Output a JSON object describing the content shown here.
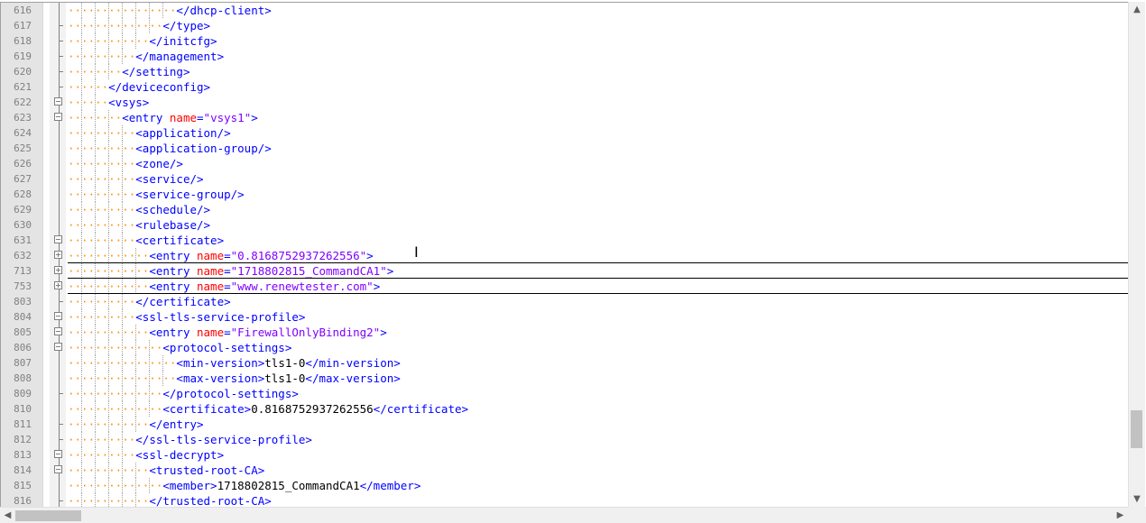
{
  "editor": {
    "lines": [
      {
        "num": "616",
        "indent": 8,
        "fold": "line",
        "tokens": [
          [
            "tag",
            "</dhcp-client>"
          ]
        ]
      },
      {
        "num": "617",
        "indent": 7,
        "fold": "end",
        "tokens": [
          [
            "tag",
            "</type>"
          ]
        ]
      },
      {
        "num": "618",
        "indent": 6,
        "fold": "end",
        "tokens": [
          [
            "tag",
            "</initcfg>"
          ]
        ]
      },
      {
        "num": "619",
        "indent": 5,
        "fold": "end",
        "tokens": [
          [
            "tag",
            "</management>"
          ]
        ]
      },
      {
        "num": "620",
        "indent": 4,
        "fold": "end",
        "tokens": [
          [
            "tag",
            "</setting>"
          ]
        ]
      },
      {
        "num": "621",
        "indent": 3,
        "fold": "end",
        "tokens": [
          [
            "tag",
            "</deviceconfig>"
          ]
        ]
      },
      {
        "num": "622",
        "indent": 3,
        "fold": "minus",
        "tokens": [
          [
            "tag",
            "<vsys>"
          ]
        ]
      },
      {
        "num": "623",
        "indent": 4,
        "fold": "minus",
        "tokens": [
          [
            "tag",
            "<entry "
          ],
          [
            "attr",
            "name"
          ],
          [
            "tag",
            "="
          ],
          [
            "val",
            "\"vsys1\""
          ],
          [
            "tag",
            ">"
          ]
        ]
      },
      {
        "num": "624",
        "indent": 5,
        "fold": "line",
        "tokens": [
          [
            "tag",
            "<application/>"
          ]
        ]
      },
      {
        "num": "625",
        "indent": 5,
        "fold": "line",
        "tokens": [
          [
            "tag",
            "<application-group/>"
          ]
        ]
      },
      {
        "num": "626",
        "indent": 5,
        "fold": "line",
        "tokens": [
          [
            "tag",
            "<zone/>"
          ]
        ]
      },
      {
        "num": "627",
        "indent": 5,
        "fold": "line",
        "tokens": [
          [
            "tag",
            "<service/>"
          ]
        ]
      },
      {
        "num": "628",
        "indent": 5,
        "fold": "line",
        "tokens": [
          [
            "tag",
            "<service-group/>"
          ]
        ]
      },
      {
        "num": "629",
        "indent": 5,
        "fold": "line",
        "tokens": [
          [
            "tag",
            "<schedule/>"
          ]
        ]
      },
      {
        "num": "630",
        "indent": 5,
        "fold": "line",
        "tokens": [
          [
            "tag",
            "<rulebase/>"
          ]
        ]
      },
      {
        "num": "631",
        "indent": 5,
        "fold": "minus",
        "tokens": [
          [
            "tag",
            "<certificate>"
          ]
        ]
      },
      {
        "num": "632",
        "indent": 6,
        "fold": "plus",
        "collapsed": true,
        "tokens": [
          [
            "tag",
            "<entry "
          ],
          [
            "attr",
            "name"
          ],
          [
            "tag",
            "="
          ],
          [
            "val",
            "\"0.8168752937262556\""
          ],
          [
            "tag",
            ">"
          ]
        ]
      },
      {
        "num": "713",
        "indent": 6,
        "fold": "plus",
        "collapsed": true,
        "tokens": [
          [
            "tag",
            "<entry "
          ],
          [
            "attr",
            "name"
          ],
          [
            "tag",
            "="
          ],
          [
            "val",
            "\"1718802815_CommandCA1\""
          ],
          [
            "tag",
            ">"
          ]
        ]
      },
      {
        "num": "753",
        "indent": 6,
        "fold": "plus",
        "collapsed": true,
        "tokens": [
          [
            "tag",
            "<entry "
          ],
          [
            "attr",
            "name"
          ],
          [
            "tag",
            "="
          ],
          [
            "val",
            "\"www.renewtester.com\""
          ],
          [
            "tag",
            ">"
          ]
        ]
      },
      {
        "num": "803",
        "indent": 5,
        "fold": "end",
        "tokens": [
          [
            "tag",
            "</certificate>"
          ]
        ]
      },
      {
        "num": "804",
        "indent": 5,
        "fold": "minus",
        "tokens": [
          [
            "tag",
            "<ssl-tls-service-profile>"
          ]
        ]
      },
      {
        "num": "805",
        "indent": 6,
        "fold": "minus",
        "tokens": [
          [
            "tag",
            "<entry "
          ],
          [
            "attr",
            "name"
          ],
          [
            "tag",
            "="
          ],
          [
            "val",
            "\"FirewallOnlyBinding2\""
          ],
          [
            "tag",
            ">"
          ]
        ]
      },
      {
        "num": "806",
        "indent": 7,
        "fold": "minus",
        "tokens": [
          [
            "tag",
            "<protocol-settings>"
          ]
        ]
      },
      {
        "num": "807",
        "indent": 8,
        "fold": "line",
        "tokens": [
          [
            "tag",
            "<min-version>"
          ],
          [
            "txt",
            "tls1-0"
          ],
          [
            "tag",
            "</min-version>"
          ]
        ]
      },
      {
        "num": "808",
        "indent": 8,
        "fold": "line",
        "tokens": [
          [
            "tag",
            "<max-version>"
          ],
          [
            "txt",
            "tls1-0"
          ],
          [
            "tag",
            "</max-version>"
          ]
        ]
      },
      {
        "num": "809",
        "indent": 7,
        "fold": "end",
        "tokens": [
          [
            "tag",
            "</protocol-settings>"
          ]
        ]
      },
      {
        "num": "810",
        "indent": 7,
        "fold": "line",
        "tokens": [
          [
            "tag",
            "<certificate>"
          ],
          [
            "txt",
            "0.8168752937262556"
          ],
          [
            "tag",
            "</certificate>"
          ]
        ]
      },
      {
        "num": "811",
        "indent": 6,
        "fold": "end",
        "tokens": [
          [
            "tag",
            "</entry>"
          ]
        ]
      },
      {
        "num": "812",
        "indent": 5,
        "fold": "end",
        "tokens": [
          [
            "tag",
            "</ssl-tls-service-profile>"
          ]
        ]
      },
      {
        "num": "813",
        "indent": 5,
        "fold": "minus",
        "tokens": [
          [
            "tag",
            "<ssl-decrypt>"
          ]
        ]
      },
      {
        "num": "814",
        "indent": 6,
        "fold": "minus",
        "tokens": [
          [
            "tag",
            "<trusted-root-CA>"
          ]
        ]
      },
      {
        "num": "815",
        "indent": 7,
        "fold": "line",
        "tokens": [
          [
            "tag",
            "<member>"
          ],
          [
            "txt",
            "1718802815_CommandCA1"
          ],
          [
            "tag",
            "</member>"
          ]
        ]
      },
      {
        "num": "816",
        "indent": 6,
        "fold": "end",
        "tokens": [
          [
            "tag",
            "</trusted-root-CA>"
          ]
        ]
      }
    ]
  },
  "scrollbars": {
    "vertical": {
      "up_icon": "triangle-up-icon",
      "down_icon": "triangle-down-icon",
      "position": 0.9,
      "thumb_fraction": 0.08
    },
    "horizontal": {
      "left_icon": "triangle-left-icon",
      "right_icon": "triangle-right-icon",
      "position": 0.0,
      "thumb_fraction": 0.06
    }
  },
  "colors": {
    "tag": "#0000ff",
    "attribute": "#ff0000",
    "value": "#8000ff",
    "text": "#000000",
    "indent_dots": "#ff8c00",
    "line_number": "#808080"
  }
}
